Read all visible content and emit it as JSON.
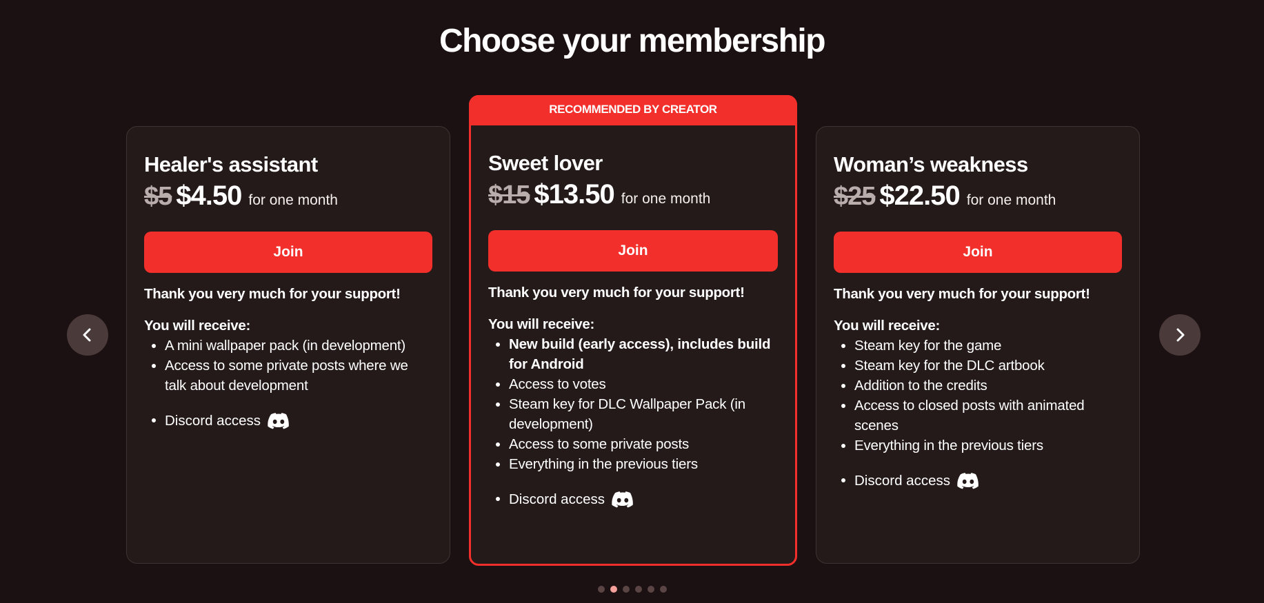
{
  "page": {
    "title": "Choose your membership"
  },
  "tiers": [
    {
      "name": "Healer's assistant",
      "old_price": "$5",
      "price": "$4.50",
      "period": "for one month",
      "join_label": "Join",
      "thanks": "Thank you very much for your support!",
      "receive_label": "You will receive:",
      "benefits": [
        "A mini wallpaper pack (in development)",
        "Access to some private posts where we talk about development"
      ],
      "discord_label": "Discord access"
    },
    {
      "badge": "RECOMMENDED BY CREATOR",
      "name": "Sweet lover",
      "old_price": "$15",
      "price": "$13.50",
      "period": "for one month",
      "join_label": "Join",
      "thanks": "Thank you very much for your support!",
      "receive_label": "You will receive:",
      "benefits": [
        "New build (early access), includes build for Android",
        "Access to votes",
        "Steam key for DLC Wallpaper Pack (in development)",
        "Access to some private posts",
        "Everything in the previous tiers"
      ],
      "discord_label": "Discord access"
    },
    {
      "name": "Woman’s weakness",
      "old_price": "$25",
      "price": "$22.50",
      "period": "for one month",
      "join_label": "Join",
      "thanks": "Thank you very much for your support!",
      "receive_label": "You will receive:",
      "benefits": [
        "Steam key for the game",
        "Steam key for the DLC artbook",
        "Addition to the credits",
        "Access to closed posts with animated scenes",
        "Everything in the previous tiers"
      ],
      "discord_label": "Discord access"
    }
  ],
  "carousel": {
    "page_count": 6,
    "active_page": 2
  },
  "icons": {
    "prev": "chevron-left-icon",
    "next": "chevron-right-icon",
    "discord": "discord-icon"
  },
  "colors": {
    "background": "#1c1112",
    "card": "#241a1a",
    "accent": "#f22f2b",
    "strike": "#b9aeab",
    "dot_active": "#f5a09a",
    "dot_inactive": "#5a4444"
  }
}
